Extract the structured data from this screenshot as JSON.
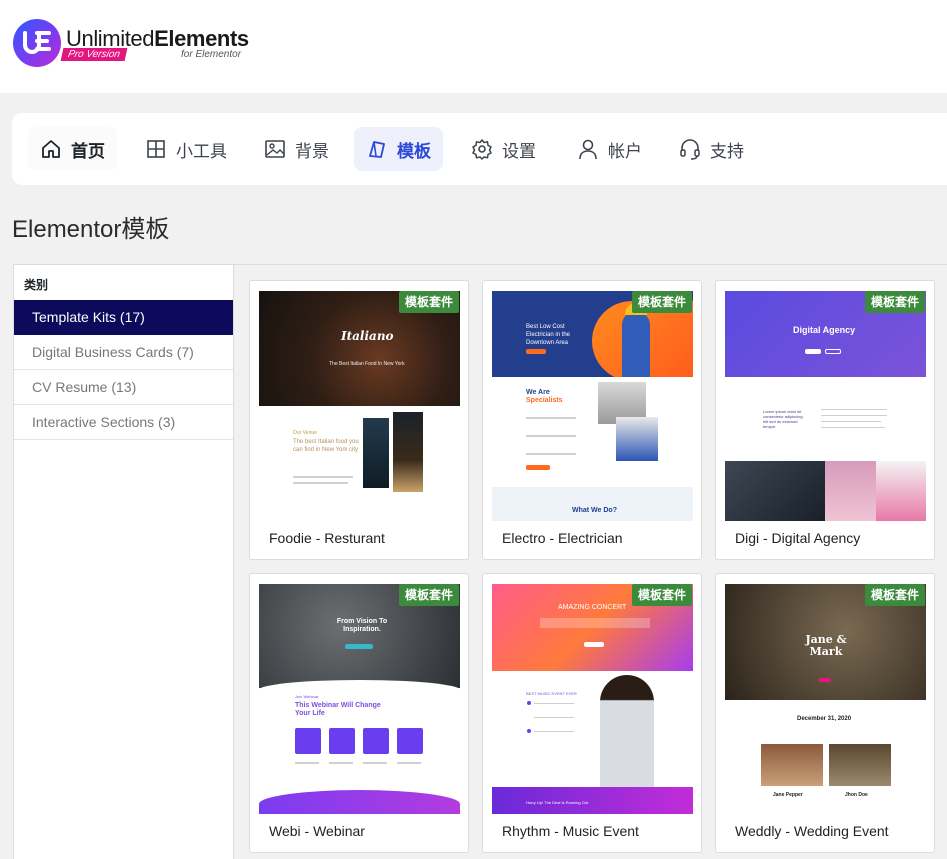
{
  "brand": {
    "name_regular": "Unlimited",
    "name_bold": "Elements",
    "pro_label": "Pro Version",
    "for_label": "for Elementor"
  },
  "nav": {
    "items": [
      {
        "label": "首页",
        "icon": "home-icon"
      },
      {
        "label": "小工具",
        "icon": "widgets-grid-icon"
      },
      {
        "label": "背景",
        "icon": "image-icon"
      },
      {
        "label": "模板",
        "icon": "template-icon"
      },
      {
        "label": "设置",
        "icon": "gear-icon"
      },
      {
        "label": "帐户",
        "icon": "user-icon"
      },
      {
        "label": "支持",
        "icon": "headset-icon"
      }
    ],
    "active": "模板"
  },
  "page": {
    "title": "Elementor模板"
  },
  "sidebar": {
    "heading": "类别",
    "categories": [
      {
        "label": "Template Kits (17)",
        "active": true
      },
      {
        "label": "Digital Business Cards (7)",
        "active": false
      },
      {
        "label": "CV Resume (13)",
        "active": false
      },
      {
        "label": "Interactive Sections (3)",
        "active": false
      }
    ]
  },
  "templates": [
    {
      "title": "Foodie - Resturant",
      "badge": "模板套件",
      "preview": {
        "hero": "Italiano",
        "sub": "The Best Italian Food In New York",
        "label": "Our Venue",
        "heading": "The best Italian food you can find in New York city"
      }
    },
    {
      "title": "Electro - Electrician",
      "badge": "模板套件",
      "preview": {
        "hero": "Best Low Cost Electrician in the Downtown Area",
        "label": "We Are",
        "heading": "Specialists",
        "footer": "What We Do?"
      }
    },
    {
      "title": "Digi - Digital Agency",
      "badge": "模板套件",
      "preview": {
        "hero": "Digital Agency",
        "heading": "Lorem ipsum dolor sit consectetur adipiscing elit sed do eiusmod tempor"
      }
    },
    {
      "title": "Webi - Webinar",
      "badge": "模板套件",
      "preview": {
        "hero": "From Vision To Inspiration.",
        "label": "Join Webinar",
        "heading": "This Webinar Will Change Your Life"
      }
    },
    {
      "title": "Rhythm - Music Event",
      "badge": "模板套件",
      "preview": {
        "hero": "AMAZING CONCERT",
        "label": "BEST MUSIC EVENT EVER",
        "footer": "Hurry Up! The Deal Is Running Out"
      }
    },
    {
      "title": "Weddly - Wedding Event",
      "badge": "模板套件",
      "preview": {
        "hero": "Jane & Mark",
        "date": "December 31, 2020",
        "person1": "Jane Pepper",
        "person2": "Jhon Doe"
      }
    }
  ],
  "colors": {
    "accent": "#2c49d8",
    "sidebar_active": "#0d0a5c",
    "badge": "#3c8b3c",
    "pro_badge": "#e3157e"
  }
}
